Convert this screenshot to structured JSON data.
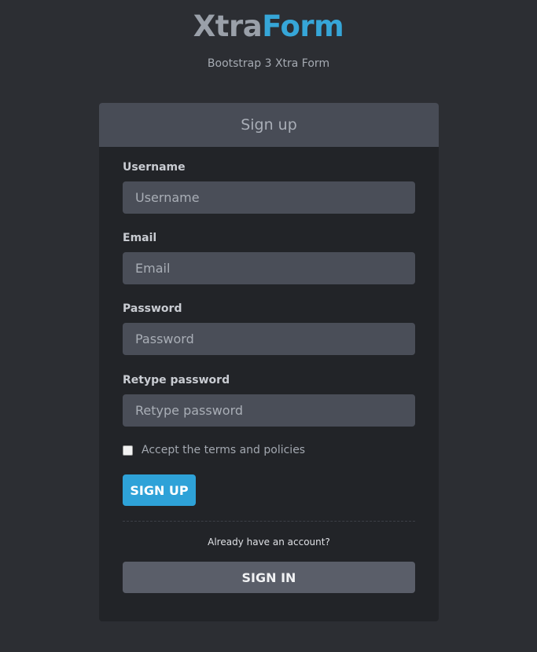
{
  "brand": {
    "part1": "Xtra",
    "part2": "Form"
  },
  "subtitle": "Bootstrap 3 Xtra Form",
  "panel": {
    "title": "Sign up"
  },
  "form": {
    "username": {
      "label": "Username",
      "placeholder": "Username",
      "value": ""
    },
    "email": {
      "label": "Email",
      "placeholder": "Email",
      "value": ""
    },
    "password": {
      "label": "Password",
      "placeholder": "Password",
      "value": ""
    },
    "retype_password": {
      "label": "Retype password",
      "placeholder": "Retype password",
      "value": ""
    },
    "terms_label": "Accept the terms and policies",
    "terms_checked": false,
    "signup_label": "SIGN UP",
    "already_text": "Already have an account?",
    "signin_label": "SIGN IN"
  },
  "colors": {
    "page_bg": "#2c2e33",
    "panel_bg": "#222428",
    "header_bg": "#484c56",
    "input_bg": "#4a4e58",
    "accent": "#2ea2d8",
    "signin_bg": "#5a5e69",
    "brand_gray": "#9aa0a9",
    "brand_blue": "#36a6d8"
  }
}
